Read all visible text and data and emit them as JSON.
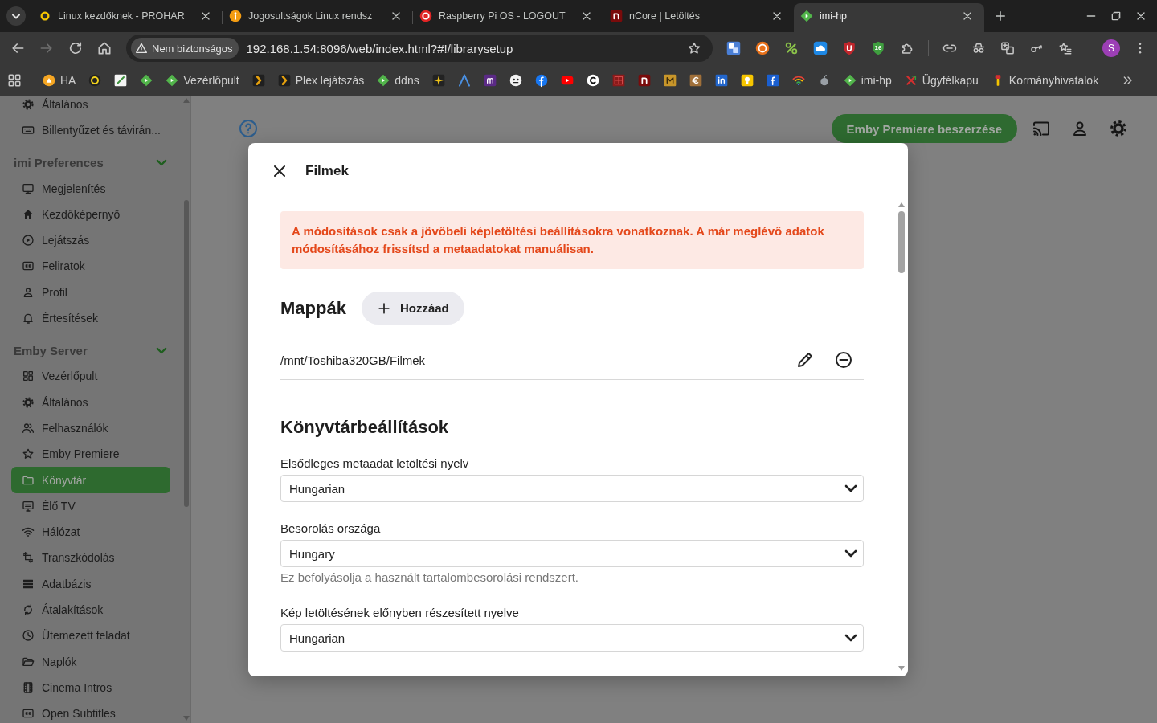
{
  "browser": {
    "tabs": [
      {
        "title": "Linux kezdőknek - PROHAR",
        "selected": false
      },
      {
        "title": "Jogosultságok Linux rendsz",
        "selected": false
      },
      {
        "title": "Raspberry Pi OS - LOGOUT",
        "selected": false
      },
      {
        "title": "nCore | Letöltés",
        "selected": false
      },
      {
        "title": "imi-hp",
        "selected": true
      }
    ],
    "address": {
      "security": "Nem biztonságos",
      "url": "192.168.1.54:8096/web/index.html?#!/librarysetup"
    },
    "extension_badge": "16",
    "profile_initial": "S",
    "bookmarks": [
      "HA",
      "Vezérlőpult",
      "Plex lejátszás",
      "ddns",
      "imi-hp",
      "Ügyfélkapu",
      "Kormányhivatalok"
    ]
  },
  "sidebar": {
    "sections": [
      {
        "items": [
          {
            "label": "Általános",
            "selected": false
          },
          {
            "label": "Billentyűzet és távirán...",
            "selected": false
          }
        ]
      },
      {
        "title": "imi Preferences",
        "expanded": true,
        "items": [
          {
            "label": "Megjelenítés",
            "selected": false
          },
          {
            "label": "Kezdőképernyő",
            "selected": false
          },
          {
            "label": "Lejátszás",
            "selected": false
          },
          {
            "label": "Feliratok",
            "selected": false
          },
          {
            "label": "Profil",
            "selected": false
          },
          {
            "label": "Értesítések",
            "selected": false
          }
        ]
      },
      {
        "title": "Emby Server",
        "expanded": true,
        "items": [
          {
            "label": "Vezérlőpult",
            "selected": false
          },
          {
            "label": "Általános",
            "selected": false
          },
          {
            "label": "Felhasználók",
            "selected": false
          },
          {
            "label": "Emby Premiere",
            "selected": false
          },
          {
            "label": "Könyvtár",
            "selected": true
          },
          {
            "label": "Élő TV",
            "selected": false
          },
          {
            "label": "Hálózat",
            "selected": false
          },
          {
            "label": "Transzkódolás",
            "selected": false
          },
          {
            "label": "Adatbázis",
            "selected": false
          },
          {
            "label": "Átalakítások",
            "selected": false
          },
          {
            "label": "Ütemezett feladat",
            "selected": false
          },
          {
            "label": "Naplók",
            "selected": false
          },
          {
            "label": "Cinema Intros",
            "selected": false
          },
          {
            "label": "Open Subtitles",
            "selected": false
          }
        ]
      }
    ]
  },
  "header": {
    "premiere_button": "Emby Premiere beszerzése"
  },
  "dialog": {
    "title": "Filmek",
    "notice": "A módosítások csak a jövőbeli képletöltési beállításokra vonatkoznak. A már meglévő adatok módosításához frissítsd a metaadatokat manuálisan.",
    "folders": {
      "heading": "Mappák",
      "add_button": "Hozzáad",
      "paths": [
        "/mnt/Toshiba320GB/Filmek"
      ]
    },
    "settings": {
      "heading": "Könyvtárbeállítások",
      "fields": [
        {
          "label": "Elsődleges metaadat letöltési nyelv",
          "value": "Hungarian"
        },
        {
          "label": "Besorolás országa",
          "value": "Hungary",
          "help": "Ez befolyásolja a használt tartalombesorolási rendszert."
        },
        {
          "label": "Kép letöltésének előnyben részesített nyelve",
          "value": "Hungarian"
        }
      ]
    }
  }
}
